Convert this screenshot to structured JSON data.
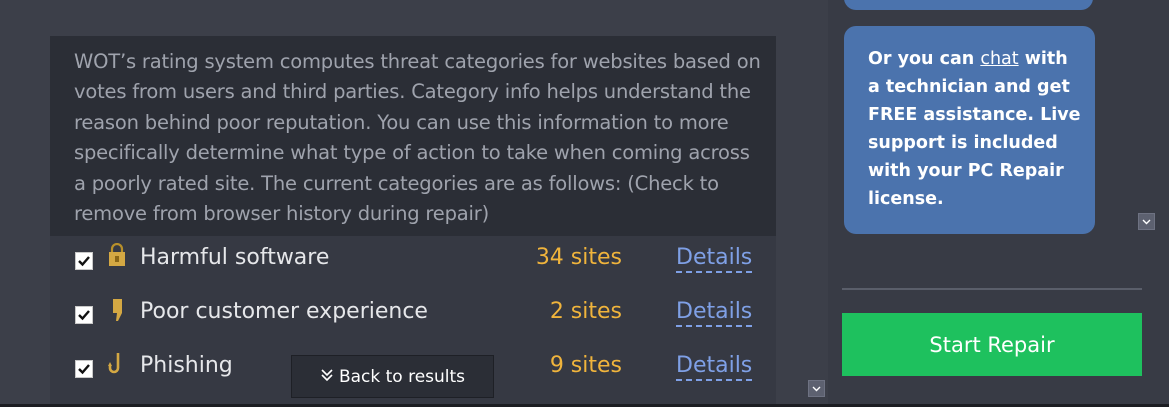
{
  "info": {
    "text": "WOT’s rating system computes threat categories for websites based on votes from users and third parties. Category info helps understand the reason behind poor reputation. You can use this information to more specifically determine what type of action to take when coming across a poorly rated site. The current categories are as follows: (Check to remove from browser history during repair)"
  },
  "categories": [
    {
      "label": "Harmful software",
      "count": "34 sites",
      "details": "Details",
      "checked": true,
      "icon": "malware-padlock-icon"
    },
    {
      "label": "Poor customer experience",
      "count": "2 sites",
      "details": "Details",
      "checked": true,
      "icon": "thumbs-down-icon"
    },
    {
      "label": "Phishing",
      "count": "9 sites",
      "details": "Details",
      "checked": true,
      "icon": "fishing-hook-icon"
    }
  ],
  "back_button": {
    "label": "Back to results",
    "icon": "double-chevron-down-icon"
  },
  "sidebar": {
    "chat_prefix": "Or you can ",
    "chat_link": "chat",
    "chat_suffix": " with a technician and get FREE assistance. Live support is included with your PC Repair license.",
    "start_repair": "Start Repair"
  },
  "colors": {
    "accent_count": "#f0b43c",
    "link": "#7fa0e6",
    "bubble": "#4b73ad",
    "start_button": "#1ec15e"
  }
}
